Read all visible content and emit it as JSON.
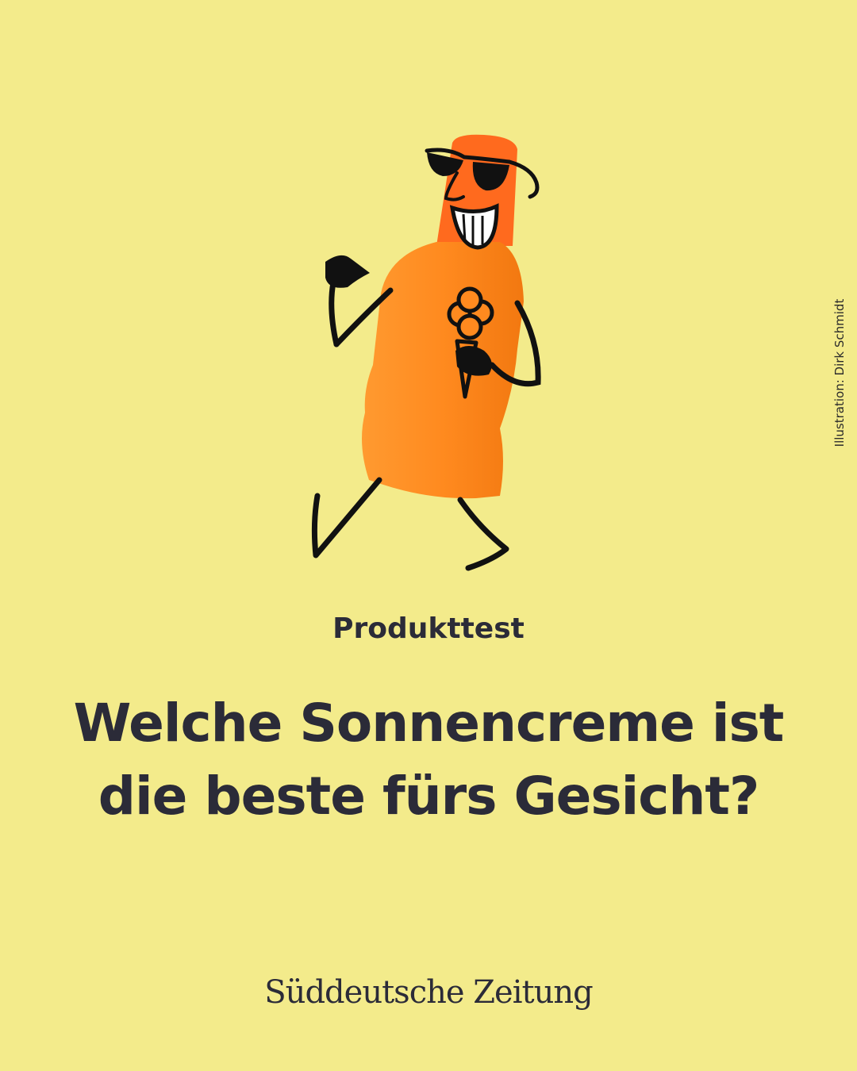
{
  "illustration": {
    "subject": "orange-sunscreen-bottle-character",
    "colors": {
      "bottle": "#ff8a1f",
      "cap": "#ff5a1a",
      "ink": "#111111",
      "background": "#f3eb8b"
    }
  },
  "credit": "Illustration: Dirk Schmidt",
  "kicker": "Produkttest",
  "headline": {
    "line1": "Welche Sonnencreme ist",
    "line2": "die beste fürs Gesicht?"
  },
  "logo": "Süddeutsche Zeitung"
}
